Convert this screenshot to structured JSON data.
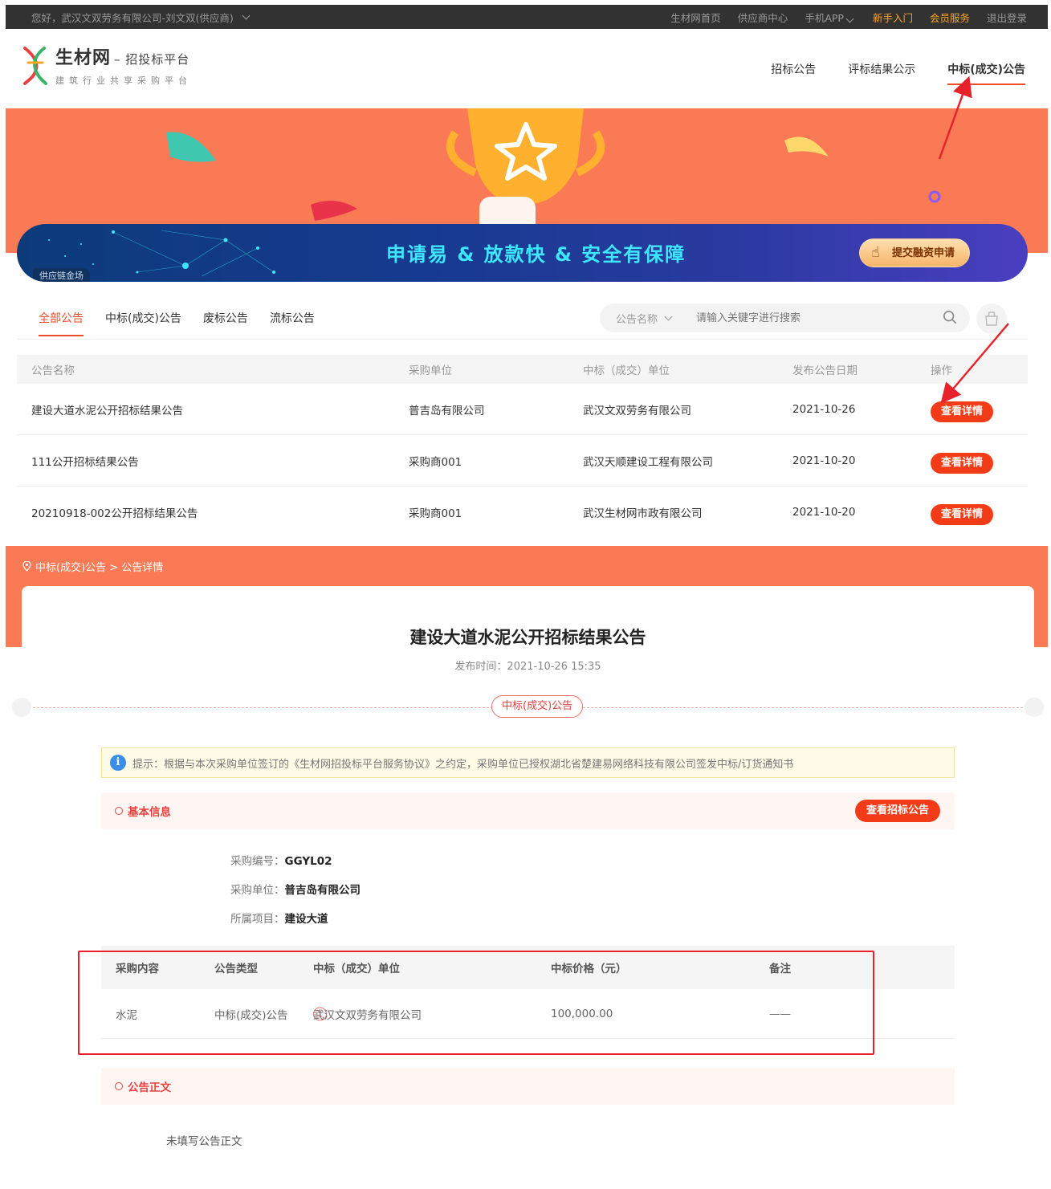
{
  "topbar": {
    "greeting": "您好，武汉文双劳务有限公司-刘文双(供应商)",
    "links": [
      "生材网首页",
      "供应商中心",
      "手机APP",
      "新手入门",
      "会员服务",
      "退出登录"
    ]
  },
  "header": {
    "logo_name": "生材网",
    "logo_suffix": "– 招投标平台",
    "logo_tagline": "建筑行业共享采购平台",
    "nav": [
      "招标公告",
      "评标结果公示",
      "中标(成交)公告"
    ]
  },
  "finance_banner": {
    "slogan": "申请易 & 放款快 & 安全有保障",
    "tag": "供应链金场",
    "button": "提交融资申请"
  },
  "tabs": [
    "全部公告",
    "中标(成交)公告",
    "废标公告",
    "流标公告"
  ],
  "search": {
    "select": "公告名称",
    "placeholder": "请输入关键字进行搜索"
  },
  "results": {
    "headers": [
      "公告名称",
      "采购单位",
      "中标（成交）单位",
      "发布公告日期",
      "操作"
    ],
    "rows": [
      {
        "name": "建设大道水泥公开招标结果公告",
        "buyer": "普吉岛有限公司",
        "winner": "武汉文双劳务有限公司",
        "date": "2021-10-26",
        "action": "查看详情"
      },
      {
        "name": "111公开招标结果公告",
        "buyer": "采购商001",
        "winner": "武汉天顺建设工程有限公司",
        "date": "2021-10-20",
        "action": "查看详情"
      },
      {
        "name": "20210918-002公开招标结果公告",
        "buyer": "采购商001",
        "winner": "武汉生材网市政有限公司",
        "date": "2021-10-20",
        "action": "查看详情"
      }
    ]
  },
  "detail": {
    "breadcrumb": "中标(成交)公告 > 公告详情",
    "title": "建设大道水泥公开招标结果公告",
    "publish_time": "发布时间：2021-10-26 15:35",
    "type_tag": "中标(成交)公告",
    "tip": "提示：根据与本次采购单位签订的《生材网招投标平台服务协议》之约定，采购单位已授权湖北省楚建易网络科技有限公司签发中标/订货通知书",
    "basic_title": "基本信息",
    "view_bid_button": "查看招标公告",
    "fields": [
      {
        "label": "采购编号：",
        "value": "GGYL02"
      },
      {
        "label": "采购单位：",
        "value": "普吉岛有限公司"
      },
      {
        "label": "所属项目：",
        "value": "建设大道"
      }
    ],
    "items_headers": [
      "采购内容",
      "公告类型",
      "中标（成交）单位",
      "中标价格（元）",
      "备注"
    ],
    "items": [
      {
        "content": "水泥",
        "type": "中标(成交)公告",
        "rank": "1",
        "winner": "武汉文双劳务有限公司",
        "price": "100,000.00",
        "remark": "——"
      }
    ],
    "body_title": "公告正文",
    "body_text": "未填写公告正文"
  },
  "colors": {
    "accent": "#f23c17",
    "banner": "#fa7a55",
    "topbar": "#323232",
    "annotation": "#e8222a"
  }
}
